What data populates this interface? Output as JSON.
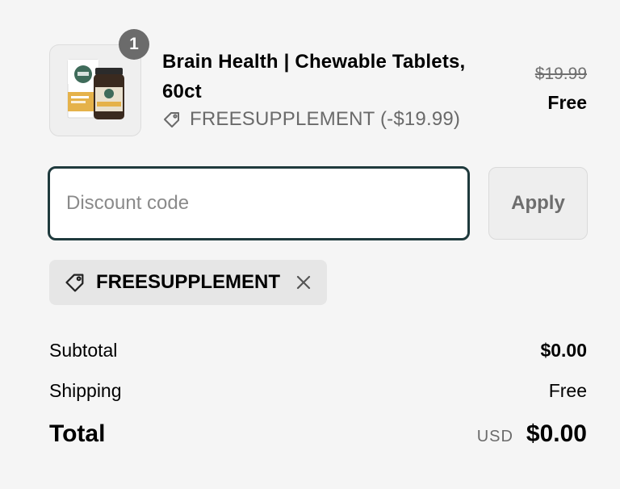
{
  "line_item": {
    "quantity": "1",
    "name": "Brain Health | Chewable Tablets, 60ct",
    "discount_label": "FREESUPPLEMENT (-$19.99)",
    "original_price": "$19.99",
    "final_price": "Free",
    "image_icon": "product-photo"
  },
  "discount": {
    "placeholder": "Discount code",
    "value": "",
    "apply_label": "Apply"
  },
  "applied_code": {
    "code": "FREESUPPLEMENT"
  },
  "summary": {
    "subtotal_label": "Subtotal",
    "subtotal_value": "$0.00",
    "shipping_label": "Shipping",
    "shipping_value": "Free",
    "total_label": "Total",
    "currency": "USD",
    "total_value": "$0.00"
  },
  "colors": {
    "background": "#f5f5f5",
    "input_border": "#1f3a3d",
    "badge": "#6b6b6b",
    "muted_text": "#6a6a6a"
  }
}
